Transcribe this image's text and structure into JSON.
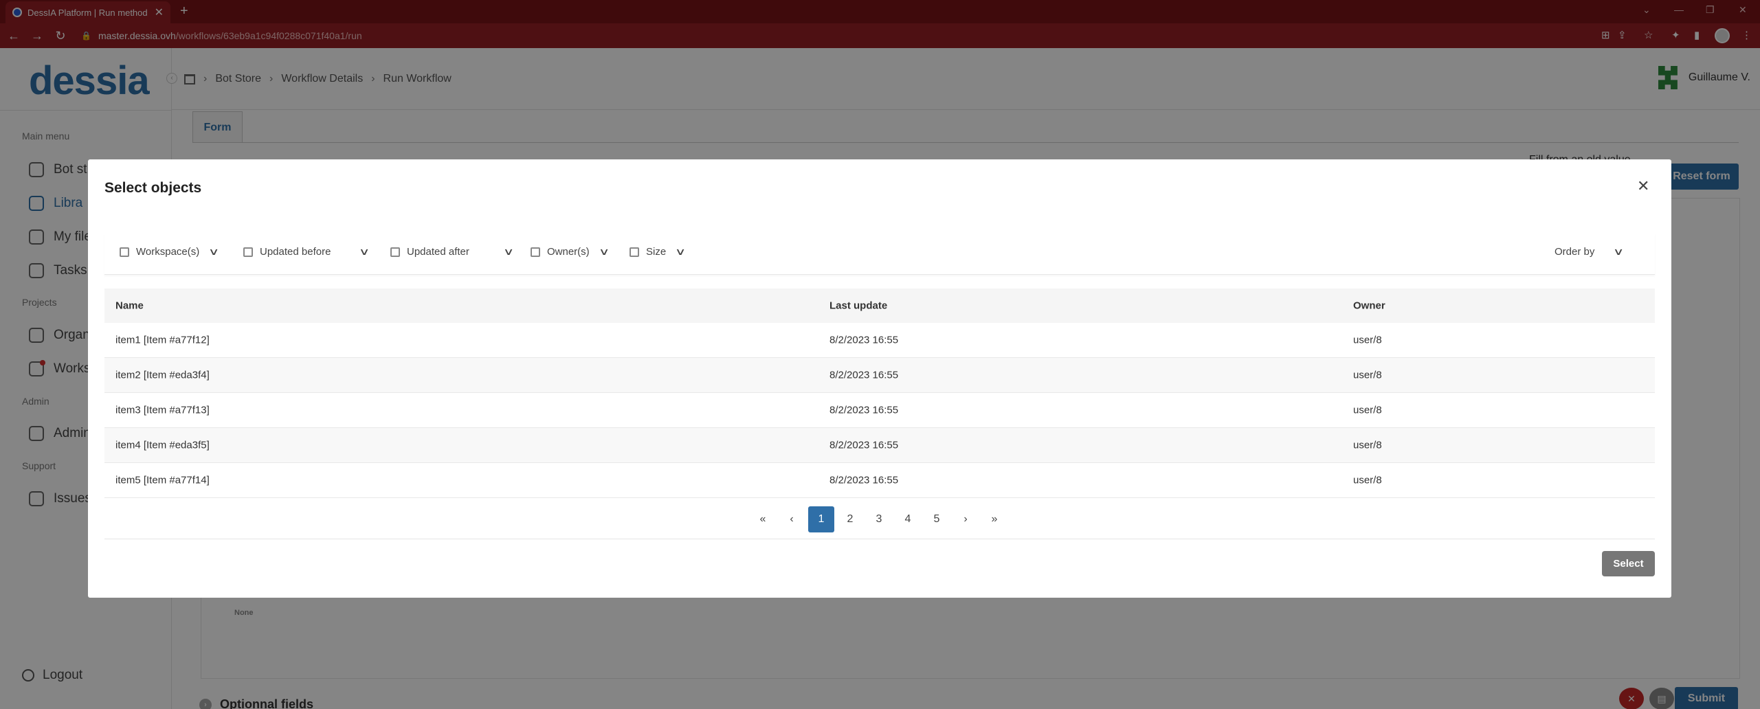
{
  "browser": {
    "tab_title": "DessIA Platform | Run method",
    "url_host": "master.dessia.ovh",
    "url_path": "/workflows/63eb9a1c94f0288c071f40a1/run"
  },
  "sidebar": {
    "logo": "dessia",
    "main_menu_label": "Main menu",
    "items": [
      {
        "label": "Bot st"
      },
      {
        "label": "Libra"
      },
      {
        "label": "My file"
      },
      {
        "label": "Tasks"
      }
    ],
    "projects_label": "Projects",
    "project_items": [
      {
        "label": "Organ"
      },
      {
        "label": "Works"
      }
    ],
    "admin_label": "Admin",
    "admin_item": "Admin",
    "support_label": "Support",
    "support_item": "Issues",
    "logout": "Logout"
  },
  "header": {
    "breadcrumb": [
      "Bot Store",
      "Workflow Details",
      "Run Workflow"
    ],
    "user_name": "Guillaume V."
  },
  "page": {
    "form_tab": "Form",
    "fill_old": "Fill from an old value",
    "reset_form": "Reset form",
    "none_text": "None",
    "optional_fields": "Optionnal fields",
    "submit": "Submit"
  },
  "modal": {
    "title": "Select objects",
    "filters": [
      "Workspace(s)",
      "Updated before",
      "Updated after",
      "Owner(s)",
      "Size"
    ],
    "order_by": "Order by",
    "columns": [
      "Name",
      "Last update",
      "Owner"
    ],
    "rows": [
      {
        "name": "item1 [Item #a77f12]",
        "updated": "8/2/2023 16:55",
        "owner": "user/8"
      },
      {
        "name": "item2 [Item #eda3f4]",
        "updated": "8/2/2023 16:55",
        "owner": "user/8"
      },
      {
        "name": "item3 [Item #a77f13]",
        "updated": "8/2/2023 16:55",
        "owner": "user/8"
      },
      {
        "name": "item4 [Item #eda3f5]",
        "updated": "8/2/2023 16:55",
        "owner": "user/8"
      },
      {
        "name": "item5 [Item #a77f14]",
        "updated": "8/2/2023 16:55",
        "owner": "user/8"
      }
    ],
    "pages": [
      "1",
      "2",
      "3",
      "4",
      "5"
    ],
    "current_page": "1",
    "select_button": "Select"
  }
}
